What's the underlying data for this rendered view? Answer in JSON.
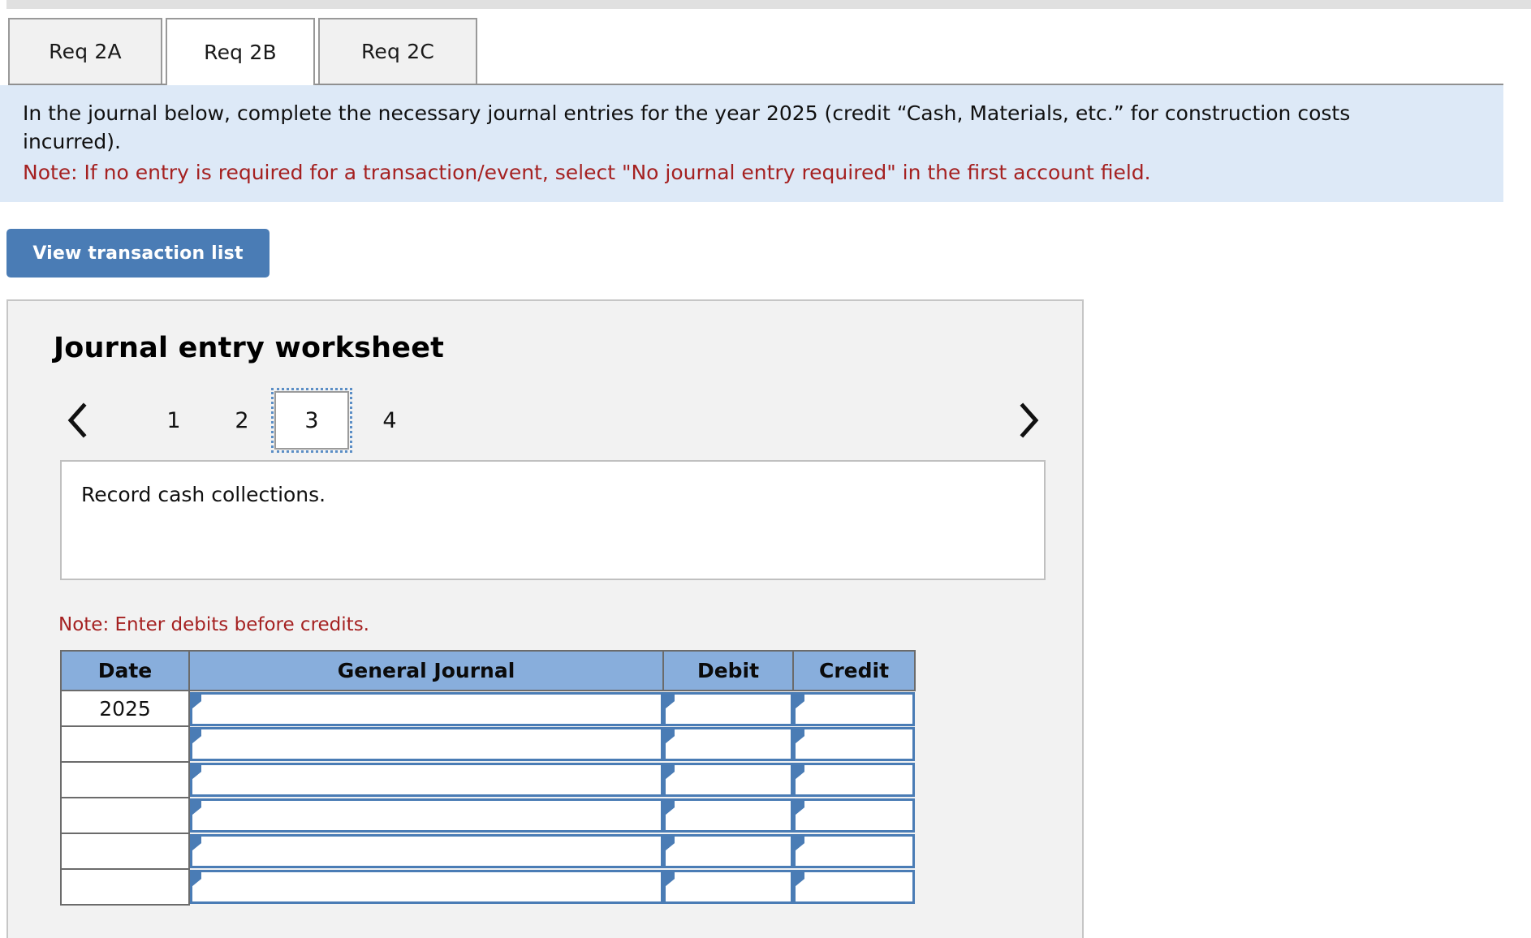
{
  "tabs": [
    {
      "label": "Req 2A",
      "active": false
    },
    {
      "label": "Req 2B",
      "active": true
    },
    {
      "label": "Req 2C",
      "active": false
    }
  ],
  "banner": {
    "instruction": "In the journal below, complete the necessary journal entries for the year 2025 (credit “Cash, Materials, etc.” for construction costs incurred).",
    "note": "Note: If no entry is required for a transaction/event, select \"No journal entry required\" in the first account field."
  },
  "toolbar": {
    "view_transaction_list_label": "View transaction list"
  },
  "worksheet": {
    "title": "Journal entry worksheet",
    "pager": {
      "prev_icon": "chevron-left-icon",
      "next_icon": "chevron-right-icon",
      "pages": [
        "1",
        "2",
        "3",
        "4"
      ],
      "current_page": "3"
    },
    "description": "Record cash collections.",
    "debits_note": "Note: Enter debits before credits.",
    "table": {
      "headers": [
        "Date",
        "General Journal",
        "Debit",
        "Credit"
      ],
      "rows": [
        {
          "date": "2025",
          "general_journal": "",
          "debit": "",
          "credit": ""
        },
        {
          "date": "",
          "general_journal": "",
          "debit": "",
          "credit": ""
        },
        {
          "date": "",
          "general_journal": "",
          "debit": "",
          "credit": ""
        },
        {
          "date": "",
          "general_journal": "",
          "debit": "",
          "credit": ""
        },
        {
          "date": "",
          "general_journal": "",
          "debit": "",
          "credit": ""
        },
        {
          "date": "",
          "general_journal": "",
          "debit": "",
          "credit": ""
        }
      ]
    }
  },
  "colors": {
    "accent_blue": "#4a7cb5",
    "header_blue": "#88aedc",
    "banner_blue": "#dde9f7",
    "note_red": "#a52121"
  }
}
